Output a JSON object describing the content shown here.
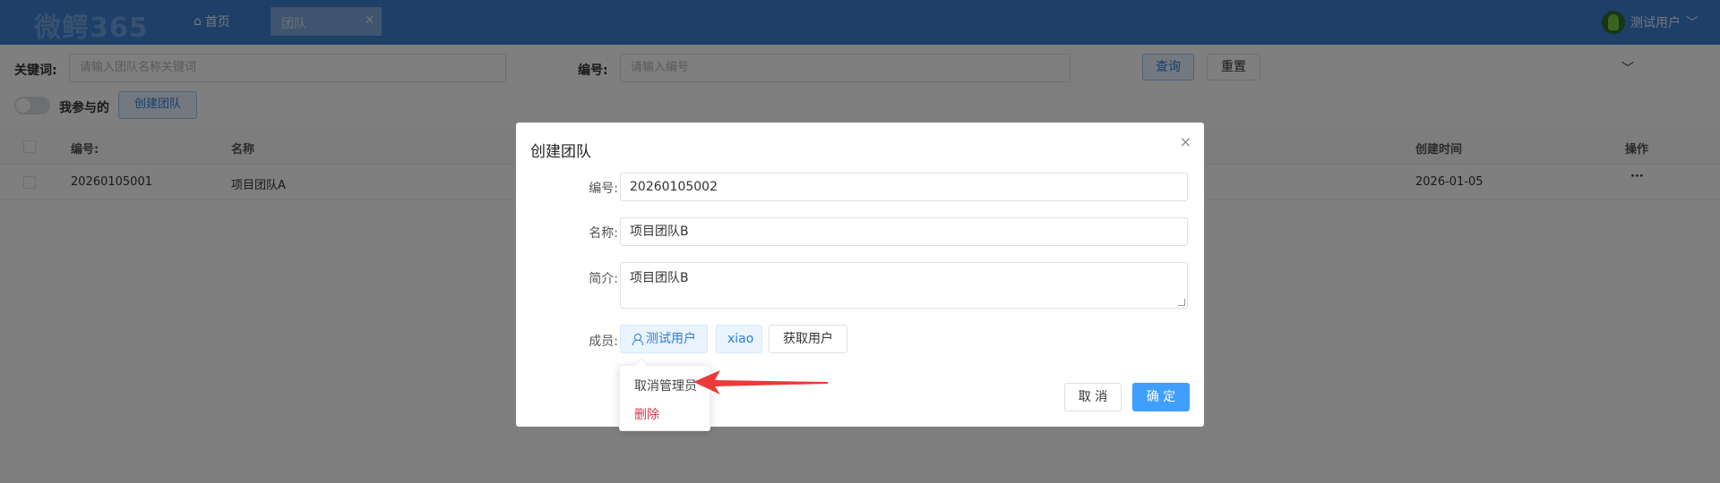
{
  "header": {
    "logo": "微鳄365",
    "home": "首页",
    "active_tab": "团队",
    "active_tab_close": "×",
    "user": "测试用户",
    "user_chevron": "﹀"
  },
  "filters": {
    "keyword_label": "关键词:",
    "keyword_placeholder": "请输入团队名称关键词",
    "code_label": "编号:",
    "code_placeholder": "请输入编号",
    "search_button": "查询",
    "reset_button": "重置",
    "expand_icon": "﹀",
    "mine_label": "我参与的",
    "create_button": "创建团队"
  },
  "table": {
    "headers": {
      "code": "编号:",
      "name": "名称",
      "created": "创建时间",
      "actions": "操作"
    },
    "rows": [
      {
        "code": "20260105001",
        "name": "项目团队A",
        "created": "2026-01-05",
        "more": "···"
      }
    ]
  },
  "modal": {
    "title": "创建团队",
    "close": "×",
    "code_label": "编号:",
    "code_value": "20260105002",
    "name_label": "名称:",
    "name_value": "项目团队B",
    "intro_label": "简介:",
    "intro_value": "项目团队B",
    "members_label": "成员:",
    "members": [
      "测试用户",
      "xiao"
    ],
    "fetch_users_button": "获取用户",
    "cancel_button": "取 消",
    "confirm_button": "确 定"
  },
  "dropdown": {
    "items": [
      {
        "label": "取消管理员"
      },
      {
        "label": "删除"
      }
    ]
  },
  "colors": {
    "header_bg": "#3b7fd0",
    "primary": "#409eff",
    "danger": "#e0334c",
    "annotation_arrow": "#ea3a3a"
  }
}
